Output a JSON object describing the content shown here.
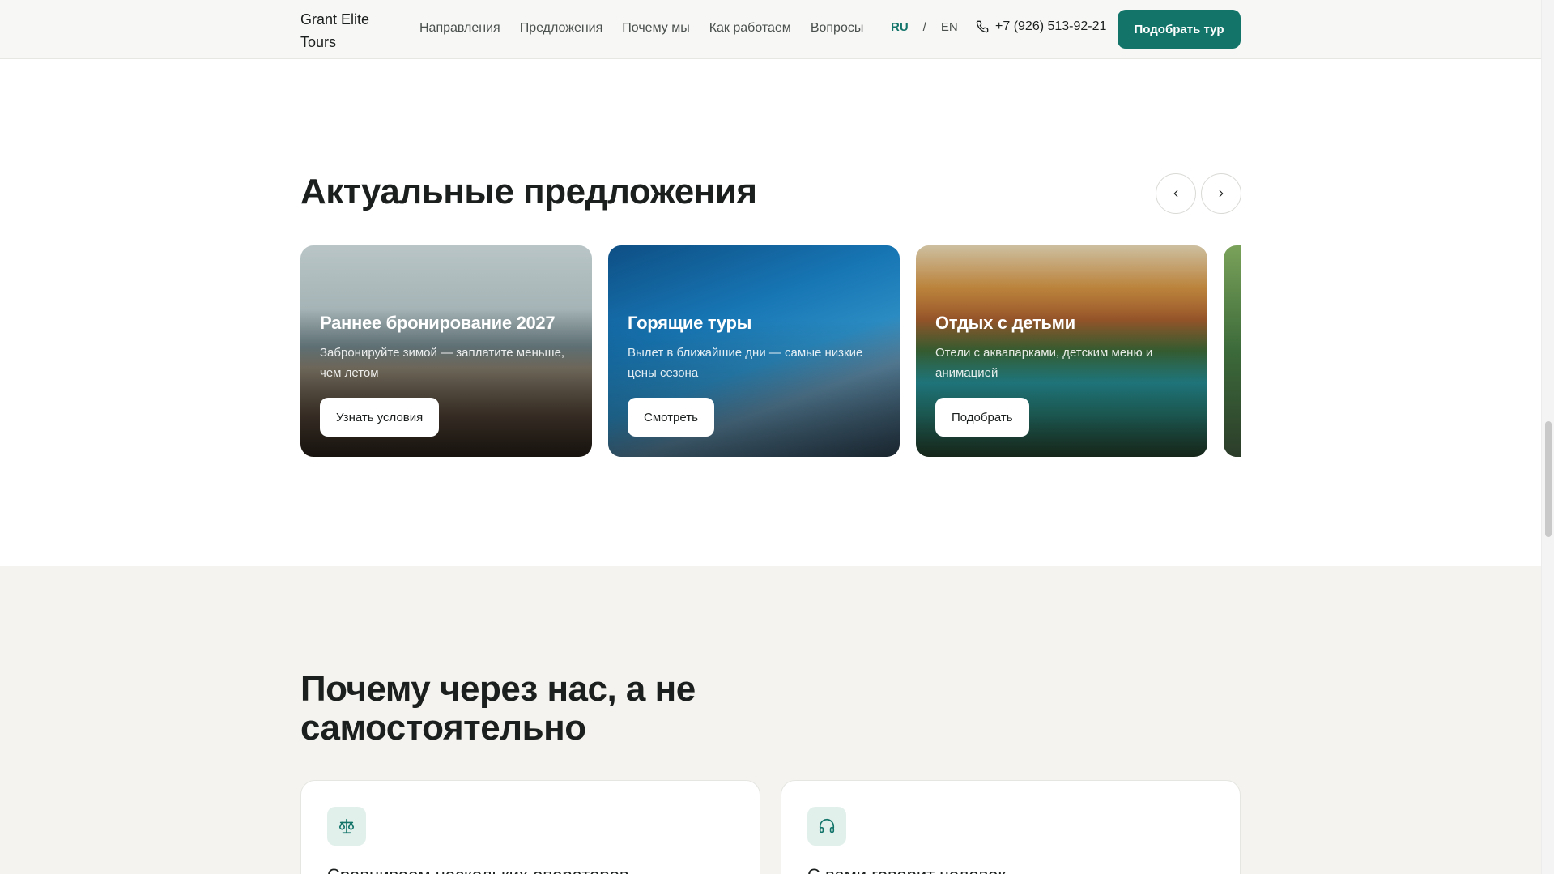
{
  "header": {
    "logo": "Grant Elite Tours",
    "nav": [
      "Направления",
      "Предложения",
      "Почему мы",
      "Как работаем",
      "Вопросы"
    ],
    "lang_ru": "RU",
    "lang_sep": "/",
    "lang_en": "EN",
    "phone": "+7 (926) 513-92-21",
    "cta": "Подобрать тур"
  },
  "offers": {
    "title": "Актуальные предложения",
    "cards": [
      {
        "title": "Раннее бронирование 2027",
        "desc": "Забронируйте зимой — заплатите меньше, чем летом",
        "button": "Узнать условия"
      },
      {
        "title": "Горящие туры",
        "desc": "Вылет в ближайшие дни — самые низкие цены сезона",
        "button": "Смотреть"
      },
      {
        "title": "Отдых с детьми",
        "desc": "Отели с аквапарками, детским меню и анимацией",
        "button": "Подобрать"
      }
    ]
  },
  "why": {
    "title": "Почему через нас, а не самостоятельно",
    "cards": [
      {
        "title": "Сравниваем нескольких операторов",
        "icon": "scales-icon"
      },
      {
        "title": "С вами говорит человек",
        "icon": "headset-icon"
      }
    ]
  },
  "colors": {
    "accent": "#13756a",
    "section_bg": "#f4f3ef",
    "icon_bg": "#e2f0ec"
  }
}
